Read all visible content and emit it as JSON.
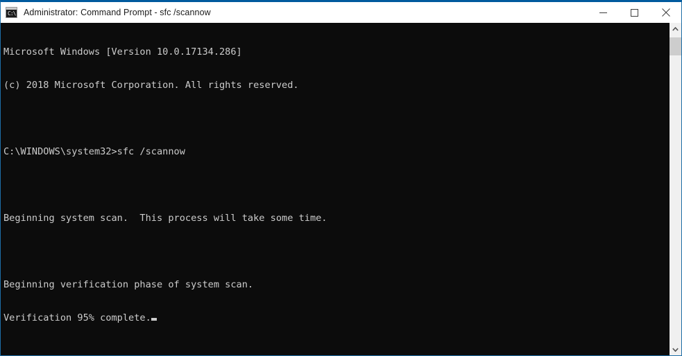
{
  "window": {
    "title": "Administrator: Command Prompt - sfc  /scannow",
    "icon": "console-icon",
    "icon_glyph": "C:\\",
    "border_color": "#1e6ea7",
    "titlebar_bg": "#ffffff",
    "titlebar_text_color": "#1a1a1a"
  },
  "controls": {
    "minimize_label": "Minimize",
    "maximize_label": "Maximize",
    "close_label": "Close"
  },
  "console": {
    "background": "#0c0c0c",
    "foreground": "#cccccc",
    "lines": [
      "Microsoft Windows [Version 10.0.17134.286]",
      "(c) 2018 Microsoft Corporation. All rights reserved.",
      "",
      "C:\\WINDOWS\\system32>sfc /scannow",
      "",
      "Beginning system scan.  This process will take some time.",
      "",
      "Beginning verification phase of system scan.",
      "Verification 95% complete."
    ],
    "cursor_visible": true,
    "progress_percent": 95,
    "command": "sfc /scannow",
    "prompt_path": "C:\\WINDOWS\\system32>"
  },
  "scrollbar": {
    "up_arrow": "chevron-up-icon",
    "down_arrow": "chevron-down-icon",
    "thumb_color": "#cdcdcd",
    "track_color": "#f0f0f0"
  }
}
